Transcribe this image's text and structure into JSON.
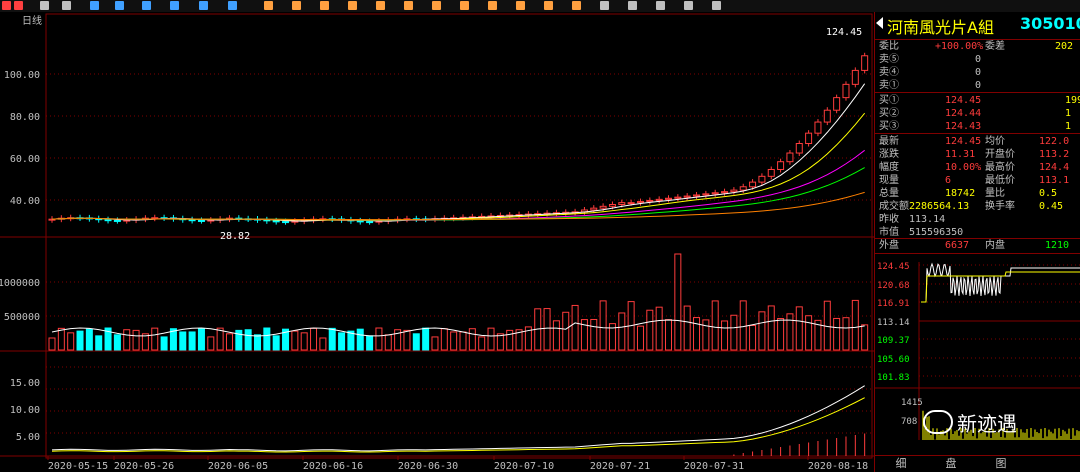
{
  "stock": {
    "name": "河南風光片A組",
    "code": "305010"
  },
  "toolbar": {
    "icons": [
      "tool-icon",
      "tool-icon",
      "tool-icon",
      "tool-icon",
      "tool-icon",
      "tool-icon",
      "tool-icon",
      "tool-icon",
      "tool-icon",
      "tool-icon",
      "tool-icon",
      "tool-icon",
      "tool-icon",
      "tool-icon",
      "tool-icon",
      "tool-icon",
      "tool-icon",
      "tool-icon",
      "tool-icon",
      "tool-icon",
      "tool-icon",
      "tool-icon",
      "tool-icon",
      "tool-icon",
      "tool-icon",
      "tool-icon",
      "tool-icon"
    ]
  },
  "chart": {
    "period": "日线",
    "price_ticks": [
      "100.00",
      "80.00",
      "60.00",
      "40.00"
    ],
    "volume_ticks": [
      "1000000",
      "500000"
    ],
    "indicator_ticks": [
      "15.00",
      "10.00",
      "5.00"
    ],
    "dates": [
      "2020-05-15",
      "2020-05-26",
      "2020-06-05",
      "2020-06-16",
      "2020-06-30",
      "2020-07-10",
      "2020-07-21",
      "2020-07-31",
      "2020-08-18"
    ],
    "high_label": "124.45",
    "low_label": "28.82"
  },
  "quote": {
    "weibi": {
      "label": "委比",
      "value": "+100.00%",
      "label2": "委差",
      "value2": "202"
    },
    "sells": [
      {
        "label": "卖⑤",
        "price": "0",
        "vol": ""
      },
      {
        "label": "卖④",
        "price": "0",
        "vol": ""
      },
      {
        "label": "卖①",
        "price": "0",
        "vol": ""
      }
    ],
    "buys": [
      {
        "label": "买①",
        "price": "124.45",
        "vol": "199"
      },
      {
        "label": "买②",
        "price": "124.44",
        "vol": "1"
      },
      {
        "label": "买③",
        "price": "124.43",
        "vol": "1"
      }
    ],
    "stats": [
      {
        "l1": "最新",
        "v1": "124.45",
        "l2": "均价",
        "v2": "122.0"
      },
      {
        "l1": "涨跌",
        "v1": "11.31",
        "l2": "开盘价",
        "v2": "113.2"
      },
      {
        "l1": "幅度",
        "v1": "10.00%",
        "l2": "最高价",
        "v2": "124.4"
      },
      {
        "l1": "现量",
        "v1": "6",
        "l2": "最低价",
        "v2": "113.1"
      },
      {
        "l1": "总量",
        "v1": "18742",
        "l2": "量比",
        "v2": "0.5"
      },
      {
        "l1": "成交额",
        "v1": "2286564.13",
        "l2": "换手率",
        "v2": "0.45"
      },
      {
        "l1": "昨收",
        "v1": "113.14",
        "l2": "",
        "v2": ""
      },
      {
        "l1": "市值",
        "v1": "515596350",
        "l2": "",
        "v2": ""
      }
    ],
    "outer": {
      "label": "外盘",
      "value": "6637",
      "label2": "内盘",
      "value2": "1210"
    }
  },
  "intraday": {
    "ticks": [
      "124.45",
      "120.68",
      "116.91",
      "113.14",
      "109.37",
      "105.60",
      "101.83"
    ],
    "vol_ticks": [
      "1415",
      "708"
    ]
  },
  "tabs": [
    "细",
    "盘",
    "图"
  ],
  "watermark": "新迹遇",
  "colors": {
    "up": "#ff3c3c",
    "down": "#00ffff",
    "grid": "#800000",
    "ma5": "#ffffff",
    "ma10": "#ffff00",
    "ma20": "#ff00ff",
    "ma30": "#00ff00",
    "ma60": "#ff8000"
  }
}
